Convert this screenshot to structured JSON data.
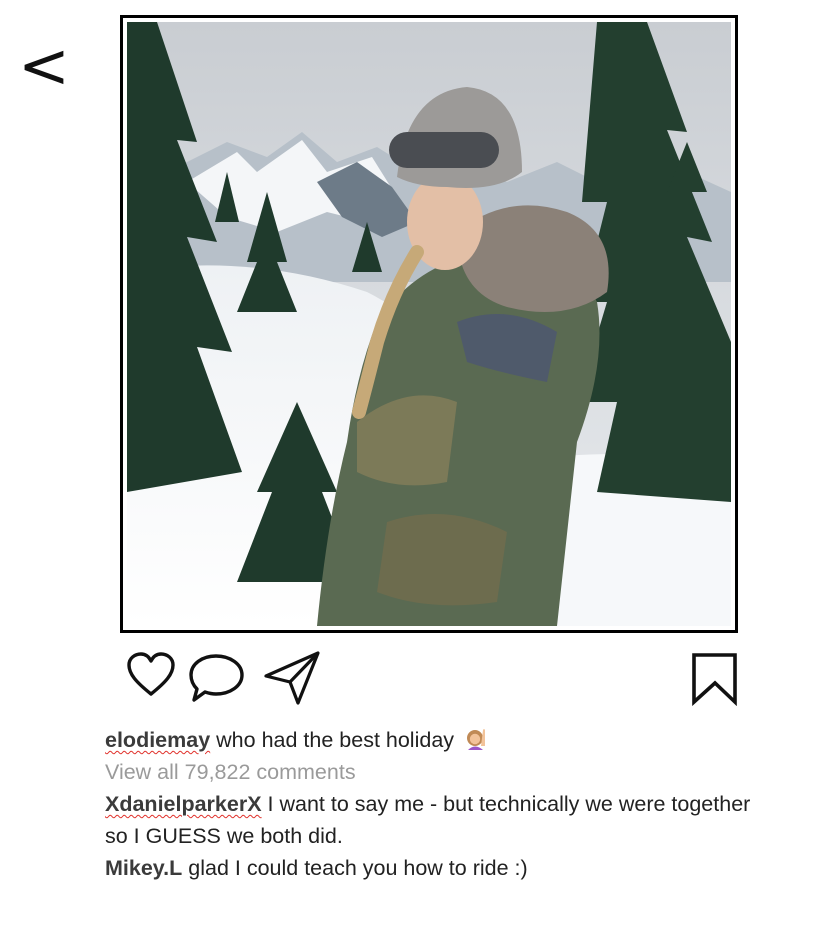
{
  "nav": {
    "back_label": "<"
  },
  "post": {
    "photo_icon": "photo-snow-portrait",
    "actions": {
      "like_icon": "heart-icon",
      "comment_icon": "comment-icon",
      "share_icon": "send-icon",
      "save_icon": "bookmark-icon"
    },
    "caption": {
      "username": "elodiemay",
      "text": "who had the best holiday",
      "emoji_icon": "person-raising-hand-emoji"
    },
    "view_comments_label": "View all 79,822 comments",
    "comments": [
      {
        "username": "XdanielparkerX",
        "text": "I want to say me - but technically we were together so I GUESS we both did."
      },
      {
        "username": "Mikey.L",
        "text": "glad I could teach you how to ride :)"
      }
    ]
  },
  "colors": {
    "text": "#222222",
    "muted": "#9a9a9a",
    "spellcheck": "#e0302a",
    "frame": "#000000"
  }
}
